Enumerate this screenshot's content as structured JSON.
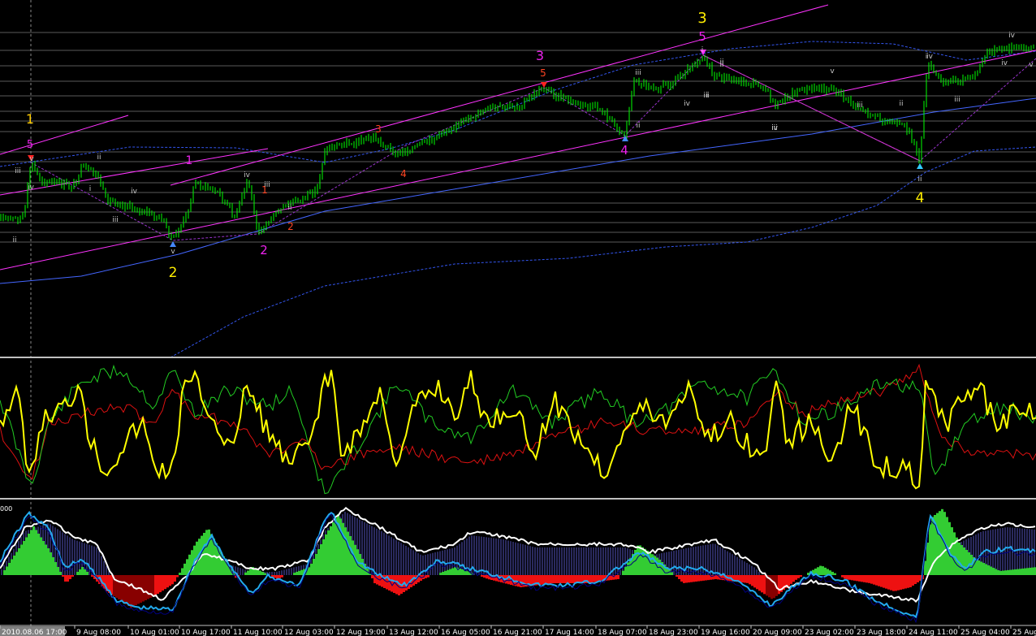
{
  "panels": {
    "price": {
      "name": "price-panel"
    },
    "oscillator": {
      "name": "oscillator-panel"
    },
    "macd": {
      "name": "macd-panel",
      "scale_label": "000"
    }
  },
  "colors": {
    "background": "#000000",
    "separator": "#c0c0c0",
    "candles": "#00ff00",
    "channel": "#ff33ff",
    "ma_blue": "#4466ff",
    "envelope": "#3355ee",
    "grid": "#5a5a5a",
    "osc_yellow": "#ffff00",
    "osc_green": "#22cc22",
    "osc_red": "#dd1111",
    "macd_green": "#33cc33",
    "macd_red": "#ee1111",
    "macd_dark_red": "#880000",
    "macd_blue_bars": "#5555bb",
    "signal_white": "#ffffff",
    "macd_cyan": "#22aaee"
  },
  "wave_labels": [
    {
      "text": "1",
      "color": "#ffcc00"
    },
    {
      "text": "5",
      "color": "#ee22ee"
    },
    {
      "text": "2",
      "color": "#ffee00"
    },
    {
      "text": "1",
      "color": "#ee22ee"
    },
    {
      "text": "1",
      "color": "#ff4422"
    },
    {
      "text": "2",
      "color": "#ff4422"
    },
    {
      "text": "2",
      "color": "#ee22ee"
    },
    {
      "text": "3",
      "color": "#ff4422"
    },
    {
      "text": "4",
      "color": "#ff4422"
    },
    {
      "text": "3",
      "color": "#ee22ee"
    },
    {
      "text": "5",
      "color": "#ff4422"
    },
    {
      "text": "4",
      "color": "#ee22ee"
    },
    {
      "text": "3",
      "color": "#ffee00"
    },
    {
      "text": "5",
      "color": "#ee22ee"
    },
    {
      "text": "4",
      "color": "#ffee00"
    }
  ],
  "roman_labels": [
    "ii",
    "iii",
    "iv",
    "v",
    "ii",
    "i",
    "iii",
    "iv",
    "v",
    "iii",
    "ii",
    "iv",
    "ii",
    "iii",
    "iv",
    "i",
    "ii",
    "iii",
    "iv",
    "v",
    "ii",
    "iii",
    "iv",
    "iv",
    "v",
    "i",
    "ii",
    "iii",
    "iv",
    "i",
    "ii",
    "iii"
  ],
  "time_axis": [
    "2010.08.06 17:00",
    "9 Aug 08:00",
    "10 Aug 01:00",
    "10 Aug 17:00",
    "11 Aug 10:00",
    "12 Aug 03:00",
    "12 Aug 19:00",
    "13 Aug 12:00",
    "16 Aug 05:00",
    "16 Aug 21:00",
    "17 Aug 14:00",
    "18 Aug 07:00",
    "18 Aug 23:00",
    "19 Aug 16:00",
    "20 Aug 09:00",
    "23 Aug 02:00",
    "23 Aug 18:00",
    "24 Aug 11:00",
    "25 Aug 04:00",
    "25 Aug"
  ]
}
